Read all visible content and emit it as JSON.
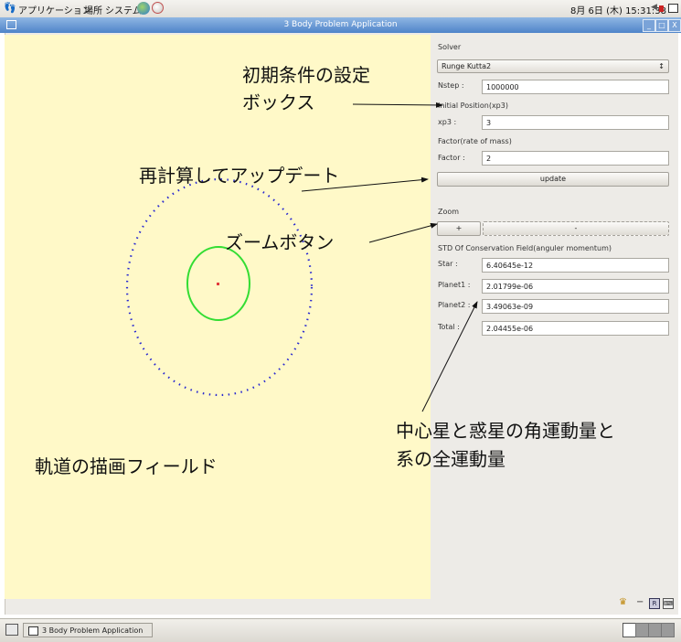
{
  "top_panel": {
    "applications": "アプリケーション",
    "places": "場所",
    "system": "システム",
    "clock": "8月 6日 (木) 15:31:38"
  },
  "window": {
    "title": "3 Body Problem Application",
    "min_glyph": "_",
    "max_glyph": "□",
    "close_glyph": "X"
  },
  "solver": {
    "heading": "Solver",
    "method": "Runge Kutta2",
    "nstep_label": "Nstep :",
    "nstep_value": "1000000"
  },
  "initial_position": {
    "heading": "Initial Position(xp3)",
    "label": "xp3 :",
    "value": "3"
  },
  "factor": {
    "heading": "Factor(rate of mass)",
    "label": "Factor :",
    "value": "2"
  },
  "update_label": "update",
  "zoom": {
    "heading": "Zoom",
    "plus_label": "+",
    "minus_label": "-"
  },
  "conservation": {
    "heading": "STD Of Conservation Field(anguler momentum)",
    "rows": [
      {
        "label": "Star :",
        "value": "6.40645e-12"
      },
      {
        "label": "Planet1 :",
        "value": "2.01799e-06"
      },
      {
        "label": "Planet2 :",
        "value": "3.49063e-09"
      },
      {
        "label": "Total :",
        "value": "2.04455e-06"
      }
    ]
  },
  "annotations": {
    "init_box_1": "初期条件の設定",
    "init_box_2": "ボックス",
    "recalc": "再計算してアップデート",
    "zoom_button": "ズームボタン",
    "momentum_1": "中心星と惑星の角運動量と",
    "momentum_2": "系の全運動量",
    "draw_field": "軌道の描画フィールド"
  },
  "taskbar": {
    "task_title": "3 Body Problem Application"
  },
  "colors": {
    "draw_field_bg": "#fff9c8",
    "outer_orbit": "#2a2ad0",
    "inner_orbit": "#33dd33",
    "center_star": "#e23b3b"
  }
}
